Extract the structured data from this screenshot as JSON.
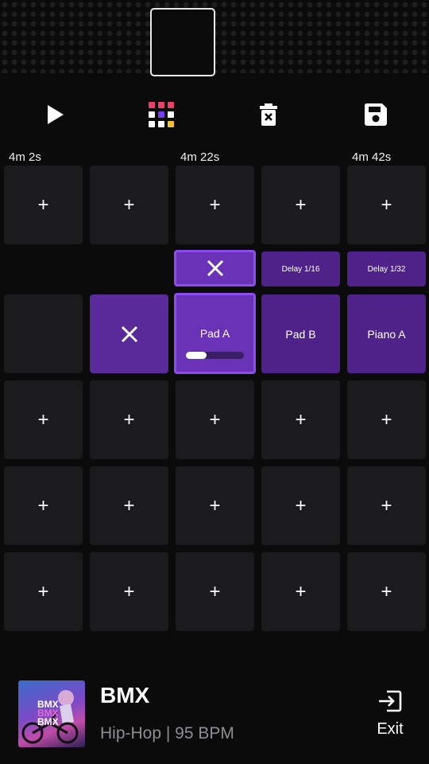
{
  "toolbar": {
    "play_icon": "play-icon",
    "grid_icon": "color-grid-icon",
    "delete_icon": "trash-icon",
    "save_icon": "save-icon"
  },
  "timeline": {
    "labels": [
      "4m 2s",
      "4m 22s",
      "4m 42s"
    ]
  },
  "grid": {
    "plus": "+",
    "effects": [
      "Delay 1/16",
      "Delay 1/32"
    ],
    "pads": [
      "Pad A",
      "Pad B",
      "Piano A"
    ],
    "pad_a_progress": 0.35
  },
  "now_playing": {
    "title": "BMX",
    "subtitle": "Hip-Hop | 95 BPM",
    "art_text": [
      "BMX",
      "BMX",
      "BMX"
    ]
  },
  "exit": {
    "label": "Exit"
  },
  "colors": {
    "accent": "#6a32b6",
    "accent_border": "#8b4cf0",
    "cell": "#1b1b1e"
  }
}
